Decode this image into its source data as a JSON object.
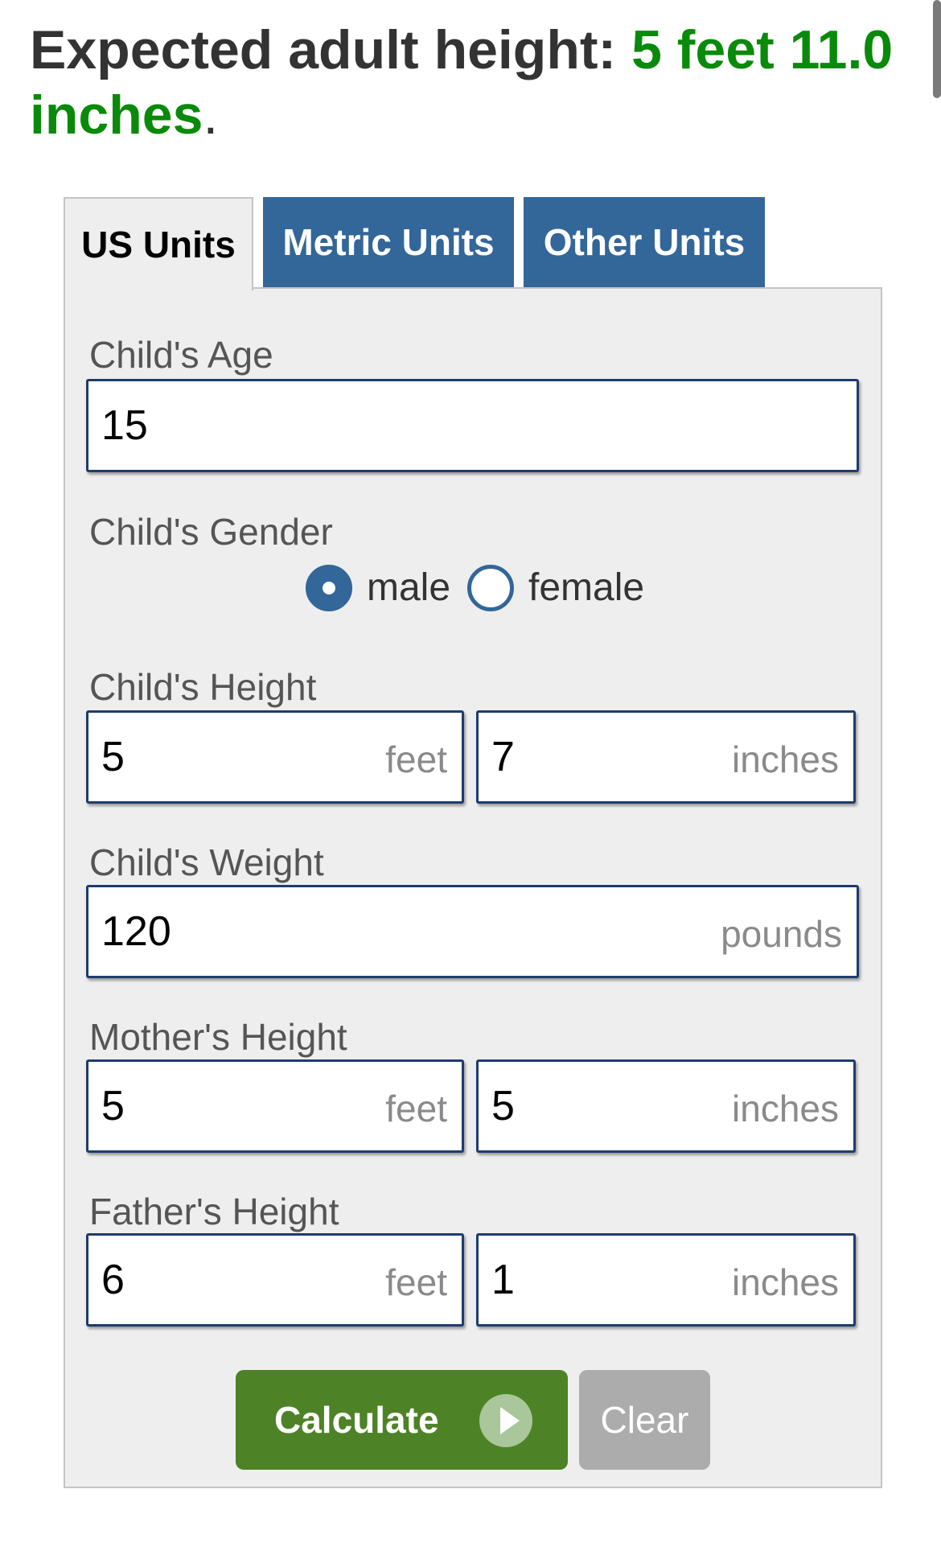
{
  "result": {
    "prefix": "Expected adult height: ",
    "value": "5 feet 11.0 inches",
    "suffix": "."
  },
  "tabs": [
    "US Units",
    "Metric Units",
    "Other Units"
  ],
  "form": {
    "age_label": "Child's Age",
    "age_value": "15",
    "gender_label": "Child's Gender",
    "gender_options": [
      "male",
      "female"
    ],
    "gender_selected": "male",
    "height_label": "Child's Height",
    "height_feet": "5",
    "height_inches": "7",
    "weight_label": "Child's Weight",
    "weight_value": "120",
    "weight_unit": "pounds",
    "mother_label": "Mother's Height",
    "mother_feet": "5",
    "mother_inches": "5",
    "father_label": "Father's Height",
    "father_feet": "6",
    "father_inches": "1",
    "unit_feet": "feet",
    "unit_inches": "inches"
  },
  "buttons": {
    "calculate": "Calculate",
    "clear": "Clear"
  },
  "colors": {
    "accent": "#336699",
    "result_green": "#0a8a0a",
    "calculate_green": "#4e8227"
  }
}
